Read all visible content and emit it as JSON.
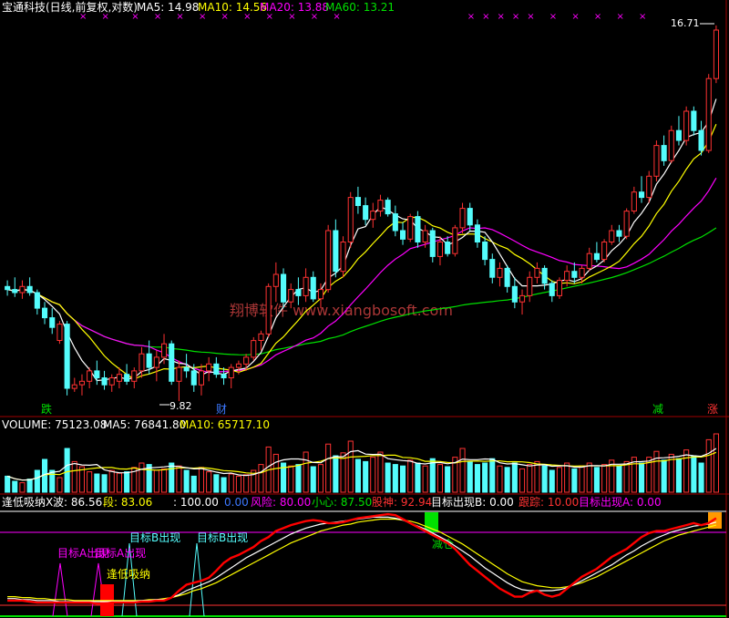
{
  "colors": {
    "up": "#ff3232",
    "down": "#54fcfc",
    "ma5": "#ffffff",
    "ma10": "#ffff00",
    "ma20": "#ff00ff",
    "ma60": "#00e000",
    "panel_line": "#a00000",
    "watermark": "#c84040"
  },
  "price_panel": {
    "stock": "宝通科技(日线,前复权,对数)",
    "ma5_label": "MA5: 14.98",
    "ma10_label": "MA10: 14.56",
    "ma20_label": "MA20: 13.88",
    "ma60_label": "MA60: 13.21",
    "high_label": "16.71",
    "low_label": "9.82",
    "markers": [
      "跌",
      "财",
      "减",
      "涨"
    ],
    "watermark": "翔博软件 www.xiangbosoft.com",
    "top_signal_glyph": "×"
  },
  "volume_panel": {
    "volume_label": "VOLUME: 75123.08",
    "ma5_label": "MA5: 76841.80",
    "ma10_label": "MA10: 65717.10"
  },
  "indicator_panel": {
    "name": "逢低吸纳X",
    "wave": "波: 86.56",
    "seg": "段: 83.06",
    "top": ": 100.00",
    "zero": "0.00",
    "risk": "风险: 80.00",
    "careful": "小心: 87.50",
    "hold": "股神: 92.94",
    "target_b": "目标出现B: 0.00",
    "follow": "跟踪: 10.00",
    "target_a": "目标出现A: 0.00",
    "ann_target_a1": "目标A出现",
    "ann_target_a2": "目标A出现",
    "ann_target_b1": "目标B出现",
    "ann_target_b2": "目标B出现",
    "ann_buy": "逢低吸纳",
    "ann_reduce": "减仓"
  },
  "chart_data": {
    "type": "candlestick",
    "y_scale": "log",
    "high": 16.71,
    "low": 9.82,
    "ohlc": [
      [
        11.55,
        11.65,
        11.4,
        11.5
      ],
      [
        11.5,
        11.7,
        11.38,
        11.45
      ],
      [
        11.45,
        11.65,
        11.35,
        11.55
      ],
      [
        11.55,
        11.7,
        11.4,
        11.45
      ],
      [
        11.45,
        11.5,
        11.1,
        11.2
      ],
      [
        11.2,
        11.3,
        10.95,
        11.05
      ],
      [
        11.05,
        11.2,
        10.8,
        10.9
      ],
      [
        10.7,
        11.0,
        10.65,
        10.95
      ],
      [
        10.95,
        11.0,
        9.9,
        10.0
      ],
      [
        10.0,
        10.15,
        9.95,
        10.05
      ],
      [
        10.05,
        10.2,
        9.9,
        10.1
      ],
      [
        10.1,
        10.3,
        10.0,
        10.25
      ],
      [
        10.25,
        10.4,
        10.05,
        10.15
      ],
      [
        10.15,
        10.25,
        9.98,
        10.05
      ],
      [
        10.05,
        10.2,
        9.95,
        10.15
      ],
      [
        10.1,
        10.3,
        10.0,
        10.2
      ],
      [
        10.2,
        10.35,
        10.05,
        10.1
      ],
      [
        10.1,
        10.3,
        10.0,
        10.25
      ],
      [
        10.25,
        10.6,
        10.15,
        10.5
      ],
      [
        10.5,
        10.7,
        10.2,
        10.3
      ],
      [
        10.3,
        10.55,
        10.1,
        10.45
      ],
      [
        10.45,
        10.8,
        10.35,
        10.65
      ],
      [
        10.65,
        10.7,
        10.05,
        10.1
      ],
      [
        10.1,
        10.4,
        9.82,
        10.3
      ],
      [
        10.3,
        10.5,
        10.15,
        10.25
      ],
      [
        10.25,
        10.35,
        9.95,
        10.05
      ],
      [
        10.05,
        10.35,
        9.9,
        10.25
      ],
      [
        10.25,
        10.45,
        10.1,
        10.35
      ],
      [
        10.35,
        10.45,
        10.15,
        10.2
      ],
      [
        10.2,
        10.3,
        10.05,
        10.15
      ],
      [
        10.15,
        10.35,
        10.0,
        10.3
      ],
      [
        10.3,
        10.4,
        10.2,
        10.35
      ],
      [
        10.35,
        10.5,
        10.25,
        10.45
      ],
      [
        10.45,
        10.75,
        10.4,
        10.7
      ],
      [
        10.7,
        10.85,
        10.55,
        10.8
      ],
      [
        10.8,
        11.6,
        10.75,
        11.55
      ],
      [
        11.55,
        11.95,
        11.3,
        11.75
      ],
      [
        11.75,
        11.85,
        11.2,
        11.3
      ],
      [
        11.3,
        11.6,
        11.2,
        11.5
      ],
      [
        11.5,
        11.7,
        11.25,
        11.4
      ],
      [
        11.4,
        11.85,
        11.3,
        11.7
      ],
      [
        11.7,
        11.8,
        11.3,
        11.35
      ],
      [
        11.35,
        11.6,
        11.2,
        11.5
      ],
      [
        11.5,
        12.6,
        11.45,
        12.5
      ],
      [
        12.5,
        12.7,
        11.7,
        11.8
      ],
      [
        11.8,
        12.4,
        11.7,
        12.3
      ],
      [
        12.3,
        13.2,
        12.2,
        13.1
      ],
      [
        13.1,
        13.3,
        12.8,
        12.95
      ],
      [
        12.95,
        13.1,
        12.6,
        12.7
      ],
      [
        12.7,
        13.0,
        12.55,
        12.85
      ],
      [
        12.85,
        13.15,
        12.75,
        13.05
      ],
      [
        13.05,
        13.1,
        12.75,
        12.8
      ],
      [
        12.8,
        12.95,
        12.4,
        12.5
      ],
      [
        12.5,
        12.65,
        12.25,
        12.35
      ],
      [
        12.35,
        12.8,
        12.3,
        12.75
      ],
      [
        12.75,
        12.85,
        12.2,
        12.3
      ],
      [
        12.3,
        12.6,
        12.2,
        12.5
      ],
      [
        12.5,
        12.55,
        11.95,
        12.05
      ],
      [
        12.05,
        12.4,
        11.9,
        12.3
      ],
      [
        12.3,
        12.4,
        12.05,
        12.1
      ],
      [
        12.1,
        12.6,
        12.05,
        12.55
      ],
      [
        12.55,
        13.0,
        12.45,
        12.9
      ],
      [
        12.9,
        13.0,
        12.5,
        12.6
      ],
      [
        12.6,
        12.7,
        12.2,
        12.3
      ],
      [
        12.3,
        12.4,
        11.9,
        12.0
      ],
      [
        12.0,
        12.1,
        11.6,
        11.7
      ],
      [
        11.7,
        11.95,
        11.55,
        11.85
      ],
      [
        11.85,
        11.9,
        11.45,
        11.55
      ],
      [
        11.55,
        11.7,
        11.2,
        11.3
      ],
      [
        11.3,
        11.5,
        11.1,
        11.4
      ],
      [
        11.4,
        11.8,
        11.3,
        11.7
      ],
      [
        11.7,
        11.95,
        11.6,
        11.85
      ],
      [
        11.85,
        11.9,
        11.5,
        11.6
      ],
      [
        11.6,
        11.65,
        11.3,
        11.4
      ],
      [
        11.4,
        11.7,
        11.35,
        11.65
      ],
      [
        11.65,
        11.9,
        11.55,
        11.8
      ],
      [
        11.8,
        11.95,
        11.6,
        11.7
      ],
      [
        11.7,
        11.9,
        11.6,
        11.85
      ],
      [
        11.85,
        12.2,
        11.8,
        12.1
      ],
      [
        12.1,
        12.3,
        11.95,
        12.0
      ],
      [
        12.0,
        12.35,
        11.95,
        12.3
      ],
      [
        12.3,
        12.6,
        12.25,
        12.5
      ],
      [
        12.5,
        12.6,
        12.3,
        12.4
      ],
      [
        12.4,
        12.9,
        12.35,
        12.85
      ],
      [
        12.85,
        13.3,
        12.8,
        13.2
      ],
      [
        13.2,
        13.5,
        13.0,
        13.1
      ],
      [
        13.1,
        13.6,
        13.0,
        13.5
      ],
      [
        13.5,
        14.2,
        13.4,
        14.1
      ],
      [
        14.1,
        14.3,
        13.7,
        13.8
      ],
      [
        13.8,
        14.5,
        13.75,
        14.4
      ],
      [
        14.4,
        14.7,
        14.1,
        14.2
      ],
      [
        14.2,
        14.9,
        14.1,
        14.8
      ],
      [
        14.8,
        14.9,
        14.3,
        14.4
      ],
      [
        14.4,
        14.6,
        13.9,
        14.0
      ],
      [
        14.0,
        15.6,
        13.95,
        15.5
      ],
      [
        15.5,
        16.71,
        15.4,
        16.6
      ]
    ],
    "volume": [
      22,
      15,
      13,
      18,
      30,
      45,
      30,
      20,
      60,
      42,
      35,
      28,
      25,
      24,
      30,
      26,
      28,
      34,
      40,
      38,
      30,
      32,
      40,
      36,
      30,
      22,
      34,
      28,
      24,
      20,
      25,
      22,
      24,
      30,
      38,
      62,
      52,
      40,
      36,
      38,
      55,
      35,
      38,
      66,
      50,
      54,
      70,
      45,
      42,
      48,
      55,
      40,
      38,
      36,
      44,
      40,
      36,
      46,
      38,
      35,
      48,
      60,
      42,
      38,
      40,
      46,
      36,
      34,
      40,
      32,
      38,
      42,
      36,
      30,
      34,
      40,
      32,
      36,
      40,
      34,
      38,
      44,
      36,
      42,
      48,
      40,
      48,
      56,
      44,
      52,
      46,
      58,
      50,
      40,
      72,
      80
    ],
    "vol_ma5": "MA5: 76841.80",
    "vol_ma10": "MA10: 65717.10",
    "indicator": {
      "red_line": [
        0.12,
        0.12,
        0.12,
        0.11,
        0.1,
        0.1,
        0.1,
        0.1,
        0.1,
        0.1,
        0.1,
        0.1,
        0.09,
        0.09,
        0.1,
        0.1,
        0.1,
        0.1,
        0.11,
        0.11,
        0.12,
        0.12,
        0.15,
        0.22,
        0.28,
        0.3,
        0.32,
        0.35,
        0.42,
        0.5,
        0.55,
        0.58,
        0.62,
        0.66,
        0.72,
        0.76,
        0.82,
        0.85,
        0.88,
        0.9,
        0.92,
        0.93,
        0.92,
        0.9,
        0.9,
        0.91,
        0.93,
        0.95,
        0.96,
        0.97,
        0.98,
        0.99,
        0.98,
        0.94,
        0.9,
        0.86,
        0.82,
        0.78,
        0.74,
        0.7,
        0.64,
        0.56,
        0.48,
        0.42,
        0.36,
        0.3,
        0.24,
        0.2,
        0.16,
        0.16,
        0.2,
        0.22,
        0.18,
        0.16,
        0.18,
        0.24,
        0.3,
        0.36,
        0.4,
        0.44,
        0.5,
        0.56,
        0.6,
        0.64,
        0.7,
        0.76,
        0.8,
        0.82,
        0.82,
        0.84,
        0.86,
        0.88,
        0.9,
        0.88,
        0.9,
        0.95
      ],
      "white_line": [
        0.14,
        0.14,
        0.13,
        0.13,
        0.12,
        0.12,
        0.12,
        0.11,
        0.11,
        0.11,
        0.11,
        0.11,
        0.11,
        0.11,
        0.11,
        0.11,
        0.11,
        0.11,
        0.12,
        0.12,
        0.13,
        0.13,
        0.15,
        0.18,
        0.22,
        0.25,
        0.28,
        0.31,
        0.35,
        0.4,
        0.45,
        0.5,
        0.55,
        0.59,
        0.63,
        0.67,
        0.71,
        0.75,
        0.79,
        0.82,
        0.85,
        0.87,
        0.89,
        0.9,
        0.91,
        0.92,
        0.93,
        0.94,
        0.95,
        0.96,
        0.96,
        0.96,
        0.95,
        0.93,
        0.9,
        0.87,
        0.84,
        0.8,
        0.76,
        0.72,
        0.67,
        0.62,
        0.57,
        0.51,
        0.45,
        0.4,
        0.35,
        0.3,
        0.26,
        0.23,
        0.22,
        0.22,
        0.22,
        0.22,
        0.23,
        0.25,
        0.28,
        0.32,
        0.36,
        0.4,
        0.44,
        0.48,
        0.53,
        0.58,
        0.62,
        0.67,
        0.71,
        0.75,
        0.78,
        0.81,
        0.83,
        0.85,
        0.87,
        0.88,
        0.89,
        0.91
      ],
      "yellow_line": [
        0.16,
        0.16,
        0.15,
        0.15,
        0.14,
        0.14,
        0.13,
        0.13,
        0.13,
        0.12,
        0.12,
        0.12,
        0.12,
        0.12,
        0.12,
        0.12,
        0.12,
        0.12,
        0.12,
        0.13,
        0.13,
        0.14,
        0.15,
        0.17,
        0.19,
        0.22,
        0.24,
        0.27,
        0.3,
        0.34,
        0.38,
        0.42,
        0.46,
        0.5,
        0.54,
        0.58,
        0.62,
        0.66,
        0.7,
        0.73,
        0.76,
        0.79,
        0.82,
        0.84,
        0.86,
        0.88,
        0.89,
        0.91,
        0.92,
        0.93,
        0.94,
        0.94,
        0.94,
        0.93,
        0.92,
        0.9,
        0.87,
        0.84,
        0.81,
        0.77,
        0.73,
        0.69,
        0.64,
        0.59,
        0.54,
        0.49,
        0.44,
        0.39,
        0.35,
        0.31,
        0.29,
        0.27,
        0.26,
        0.25,
        0.25,
        0.26,
        0.28,
        0.3,
        0.33,
        0.36,
        0.4,
        0.44,
        0.48,
        0.52,
        0.56,
        0.6,
        0.64,
        0.68,
        0.72,
        0.75,
        0.78,
        0.8,
        0.82,
        0.84,
        0.86,
        0.88
      ]
    }
  }
}
